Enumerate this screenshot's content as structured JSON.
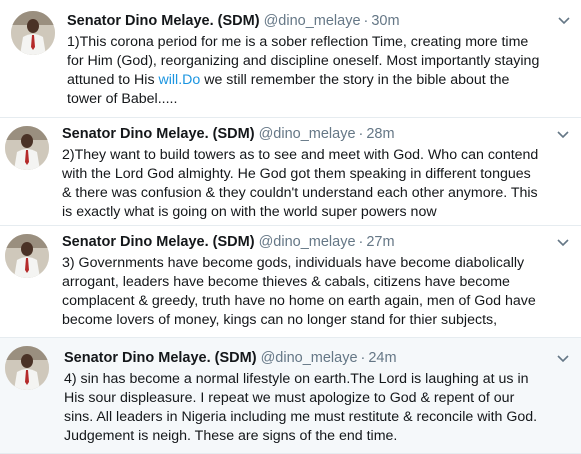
{
  "colors": {
    "text": "#14171a",
    "muted": "#657786",
    "link": "#1b95e0",
    "highlight_bg": "#f5f8fa",
    "divider": "#e6ecf0"
  },
  "tweets": [
    {
      "name": "Senator Dino Melaye. (SDM)",
      "handle": "@dino_melaye",
      "separator": "·",
      "time": "30m",
      "lines": [
        "1)This corona period for me is a sober reflection Time, creating more time",
        "for Him (God), reorganizing and discipline oneself. Most importantly staying",
        "attuned to His ",
        "we still remember the story in the bible about the",
        "tower of Babel....."
      ],
      "link_text": "will.Do"
    },
    {
      "name": "Senator Dino Melaye. (SDM)",
      "handle": "@dino_melaye",
      "separator": "·",
      "time": "28m",
      "lines": [
        "2)They want to build towers as to see and meet with God. Who can contend",
        "with the Lord God almighty. He God got them speaking in different tongues",
        "& there was confusion & they couldn't understand each other anymore. This",
        "is exactly what is going on with the world super powers now"
      ]
    },
    {
      "name": "Senator Dino Melaye. (SDM)",
      "handle": "@dino_melaye",
      "separator": "·",
      "time": "27m",
      "lines": [
        "3) Governments have become gods, individuals have become diabolically",
        "arrogant, leaders have become thieves & cabals, citizens have become",
        "complacent & greedy, truth have no home on earth again, men of God have",
        "become lovers of money, kings can no longer stand for thier subjects,"
      ]
    },
    {
      "name": "Senator Dino Melaye. (SDM)",
      "handle": "@dino_melaye",
      "separator": "·",
      "time": "24m",
      "lines": [
        "4) sin has become a normal lifestyle on earth.The Lord is laughing at us in",
        "His sour displeasure. I repeat we must  apologize to God & repent of our",
        "sins. All leaders in Nigeria including me must restitute & reconcile with God.",
        "Judgement is neigh. These are signs of the end time."
      ]
    }
  ]
}
